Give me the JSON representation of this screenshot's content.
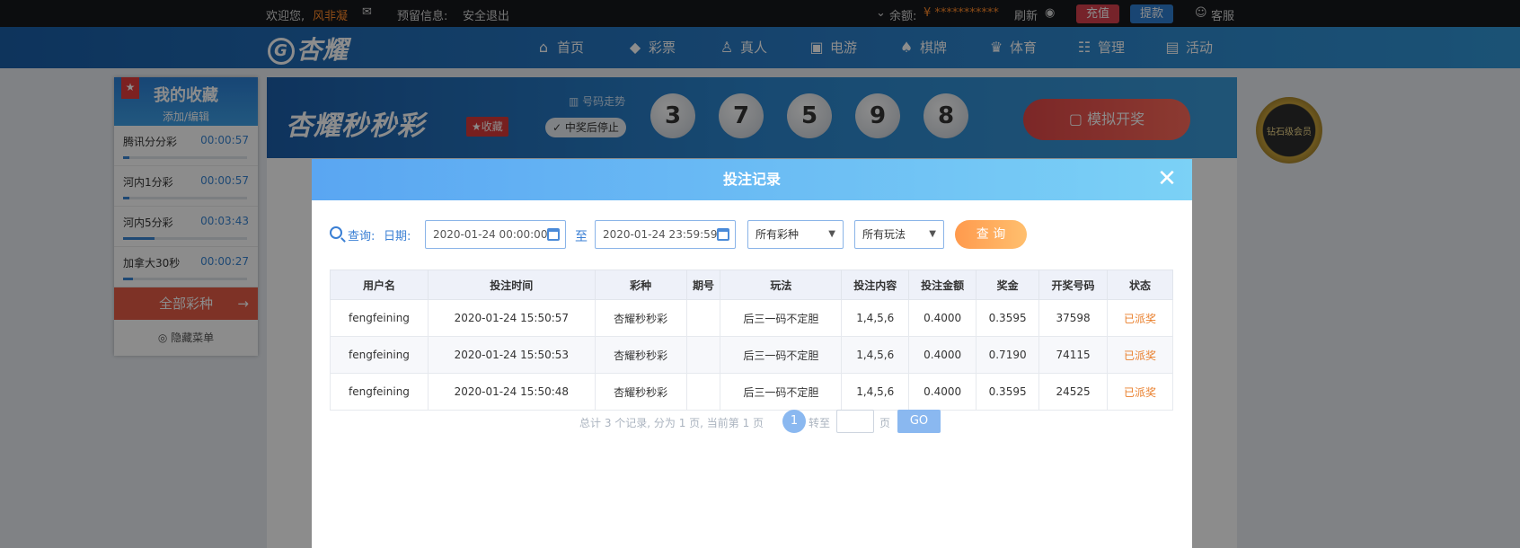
{
  "topbar": {
    "welcome": "欢迎您,",
    "username": "风非凝",
    "reserve_info": "预留信息:",
    "logout": "安全退出",
    "balance_label": "余额:",
    "balance_value": "¥ ***********",
    "refresh": "刷新",
    "deposit": "充值",
    "withdraw": "提款",
    "service": "客服"
  },
  "nav": {
    "logo": "杏耀",
    "items": [
      {
        "label": "首页",
        "icon": "home-icon"
      },
      {
        "label": "彩票",
        "icon": "ticket-icon"
      },
      {
        "label": "真人",
        "icon": "person-icon"
      },
      {
        "label": "电游",
        "icon": "gamepad-icon"
      },
      {
        "label": "棋牌",
        "icon": "card-icon"
      },
      {
        "label": "体育",
        "icon": "trophy-icon"
      },
      {
        "label": "管理",
        "icon": "users-icon"
      },
      {
        "label": "活动",
        "icon": "gift-icon"
      }
    ]
  },
  "favorites": {
    "title": "我的收藏",
    "edit": "添加/编辑",
    "items": [
      {
        "name": "腾讯分分彩",
        "time": "00:00:57",
        "progress": 0.05
      },
      {
        "name": "河内1分彩",
        "time": "00:00:57",
        "progress": 0.05
      },
      {
        "name": "河内5分彩",
        "time": "00:03:43",
        "progress": 0.25
      },
      {
        "name": "加拿大30秒",
        "time": "00:00:27",
        "progress": 0.08
      }
    ],
    "all": "全部彩种",
    "hide": "隐藏菜单"
  },
  "game": {
    "title": "杏耀秒秒彩",
    "fav_btn": "★收藏",
    "trend": "号码走势",
    "stop_after_win": "中奖后停止",
    "balls": [
      "3",
      "7",
      "5",
      "9",
      "8"
    ],
    "simulate": "模拟开奖",
    "badge": "钻石级会员"
  },
  "modal": {
    "title": "投注记录",
    "query_label": "查询:",
    "date_label": "日期:",
    "date_from": "2020-01-24 00:00:00",
    "to_label": "至",
    "date_to": "2020-01-24 23:59:59",
    "lottery_select": "所有彩种",
    "play_select": "所有玩法",
    "query_button": "查 询",
    "columns": [
      "用户名",
      "投注时间",
      "彩种",
      "期号",
      "玩法",
      "投注内容",
      "投注金额",
      "奖金",
      "开奖号码",
      "状态"
    ],
    "rows": [
      {
        "user": "fengfeining",
        "time": "2020-01-24 15:50:57",
        "lottery": "杏耀秒秒彩",
        "issue": "",
        "play": "后三一码不定胆",
        "content": "1,4,5,6",
        "amount": "0.4000",
        "prize": "0.3595",
        "draw": "37598",
        "status": "已派奖"
      },
      {
        "user": "fengfeining",
        "time": "2020-01-24 15:50:53",
        "lottery": "杏耀秒秒彩",
        "issue": "",
        "play": "后三一码不定胆",
        "content": "1,4,5,6",
        "amount": "0.4000",
        "prize": "0.7190",
        "draw": "74115",
        "status": "已派奖"
      },
      {
        "user": "fengfeining",
        "time": "2020-01-24 15:50:48",
        "lottery": "杏耀秒秒彩",
        "issue": "",
        "play": "后三一码不定胆",
        "content": "1,4,5,6",
        "amount": "0.4000",
        "prize": "0.3595",
        "draw": "24525",
        "status": "已派奖"
      }
    ],
    "pager": {
      "info": "总计 3 个记录, 分为 1 页, 当前第 1 页",
      "current": "1",
      "goto": "转至",
      "page_unit": "页",
      "go": "GO"
    }
  }
}
